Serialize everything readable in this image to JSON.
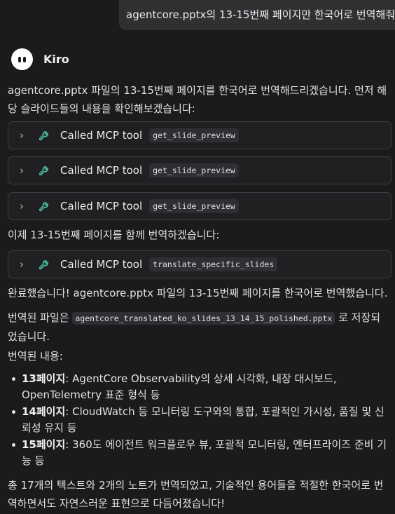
{
  "user_message": "agentcore.pptx의 13-15번째 페이지만 한국어로 번역해줘",
  "assistant": {
    "name": "Kiro",
    "intro": "agentcore.pptx 파일의 13-15번째 페이지를 한국어로 번역해드리겠습니다. 먼저 해당 슬라이드들의 내용을 확인해보겠습니다:",
    "tool_calls_1": [
      {
        "label": "Called MCP tool",
        "tool": "get_slide_preview"
      },
      {
        "label": "Called MCP tool",
        "tool": "get_slide_preview"
      },
      {
        "label": "Called MCP tool",
        "tool": "get_slide_preview"
      }
    ],
    "mid_text": "이제 13-15번째 페이지를 함께 번역하겠습니다:",
    "tool_calls_2": [
      {
        "label": "Called MCP tool",
        "tool": "translate_specific_slides"
      }
    ],
    "done_text": "완료했습니다! agentcore.pptx 파일의 13-15번째 페이지를 한국어로 번역했습니다.",
    "saved_prefix": "번역된 파일은",
    "saved_file": "agentcore_translated_ko_slides_13_14_15_polished.pptx",
    "saved_suffix": "로 저장되었습니다.",
    "content_heading": "번역된 내용:",
    "items": [
      {
        "page": "13페이지",
        "desc": ": AgentCore Observability의 상세 시각화, 내장 대시보드, OpenTelemetry 표준 형식 등"
      },
      {
        "page": "14페이지",
        "desc": ": CloudWatch 등 모니터링 도구와의 통합, 포괄적인 가시성, 품질 및 신뢰성 유지 등"
      },
      {
        "page": "15페이지",
        "desc": ": 360도 에이전트 워크플로우 뷰, 포괄적 모니터링, 엔터프라이즈 준비 기능 등"
      }
    ],
    "closing": "총 17개의 텍스트와 2개의 노트가 번역되었고, 기술적인 용어들을 적절한 한국어로 번역하면서도 자연스러운 표현으로 다듬어졌습니다!"
  },
  "icons": {
    "chevron": "chevron-right-icon",
    "tool": "wrench-icon",
    "avatar": "kiro-ghost-icon"
  },
  "colors": {
    "background": "#1b1b1d",
    "bubble": "#303033",
    "tool_icon": "#4ec9a8"
  }
}
